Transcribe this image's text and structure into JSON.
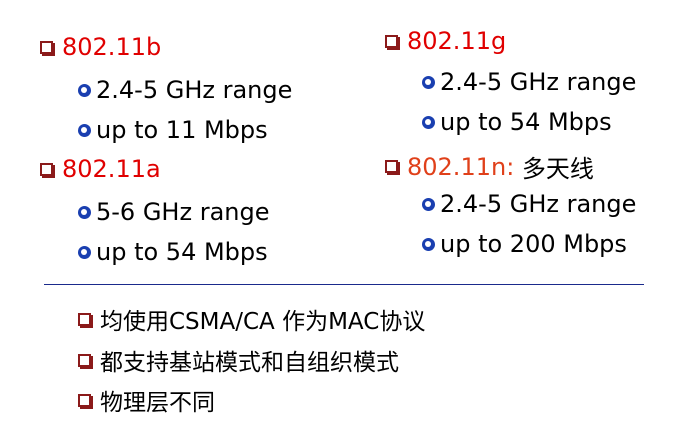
{
  "left_col": {
    "b": {
      "title": "802.11b",
      "range": "2.4-5 GHz range",
      "speed": "up to 11 Mbps"
    },
    "a": {
      "title": "802.11a",
      "range": "5-6 GHz range",
      "speed": "up to 54 Mbps"
    }
  },
  "right_col": {
    "g": {
      "title": "802.11g",
      "range": "2.4-5 GHz range",
      "speed": "up to 54 Mbps"
    },
    "n": {
      "title": "802.11n:",
      "title_suffix": " 多天线",
      "range": "2.4-5 GHz range",
      "speed": "up to 200 Mbps"
    }
  },
  "common": [
    "均使用CSMA/CA 作为MAC协议",
    "都支持基站模式和自组织模式",
    "物理层不同"
  ],
  "colors": {
    "title_red": "#e00000",
    "title_orange": "#e0401a",
    "bullet_square": "#8B1A1A",
    "bullet_dot": "#1a3fb0",
    "divider": "#1a2a8c"
  }
}
